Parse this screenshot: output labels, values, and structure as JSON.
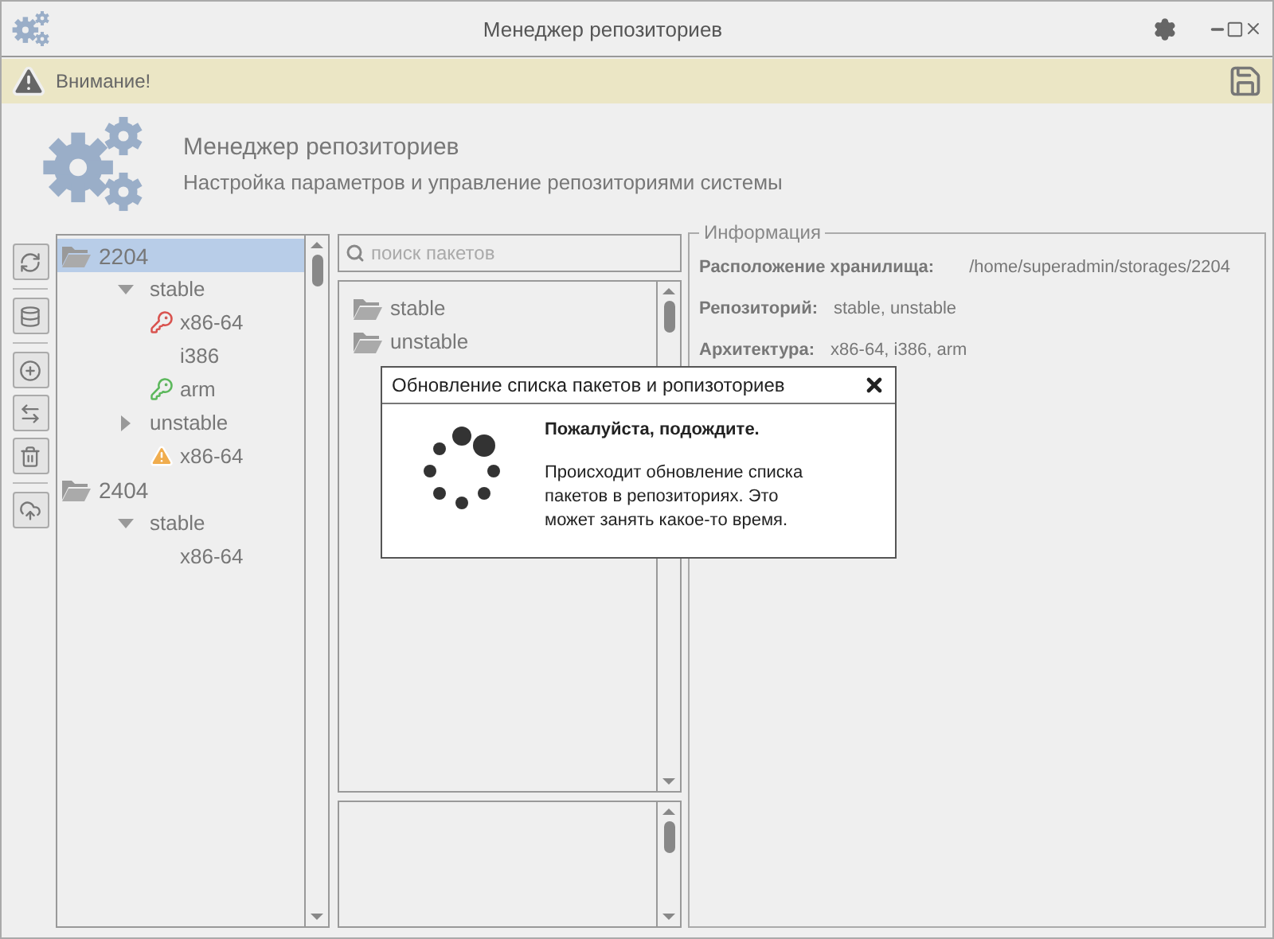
{
  "window": {
    "title": "Менеджер репозиториев"
  },
  "warning_bar": {
    "text": "Внимание!"
  },
  "header": {
    "title": "Менеджер репозиториев",
    "subtitle": "Настройка параметров и управление репозиториями системы"
  },
  "tree": [
    {
      "label": "2204",
      "selected": true,
      "expanded": true,
      "children": [
        {
          "label": "stable",
          "selected": false,
          "expanded": true,
          "children": [
            {
              "label": "x86-64",
              "selected": false,
              "kind": "error"
            },
            {
              "label": "i386",
              "selected": false,
              "kind": "plain"
            },
            {
              "label": "arm",
              "selected": false,
              "kind": "ok"
            }
          ]
        },
        {
          "label": "unstable",
          "selected": false,
          "expanded": false,
          "children": [
            {
              "label": "x86-64",
              "selected": false,
              "kind": "warning"
            }
          ]
        }
      ]
    },
    {
      "label": "2404",
      "selected": false,
      "expanded": true,
      "children": [
        {
          "label": "stable",
          "selected": false,
          "expanded": true,
          "children": [
            {
              "label": "x86-64",
              "selected": false,
              "kind": "plain"
            }
          ]
        }
      ]
    }
  ],
  "search": {
    "placeholder": "поиск пакетов"
  },
  "packages": [
    {
      "label": "stable"
    },
    {
      "label": "unstable"
    }
  ],
  "info": {
    "title": "Информация",
    "rows": [
      {
        "label": "Расположение хранилища:",
        "value": "/home/superadmin/storages/2204"
      },
      {
        "label": "Репозиторий:",
        "value": "stable, unstable"
      },
      {
        "label": "Архитектура:",
        "value": "x86-64, i386, arm"
      }
    ]
  },
  "dialog": {
    "title": "Обновление списка пакетов и ропизоториев",
    "heading": "Пожалуйста, подождите.",
    "message": "Происходит обновление списка пакетов в репозиториях. Это может занять какое-то время."
  }
}
